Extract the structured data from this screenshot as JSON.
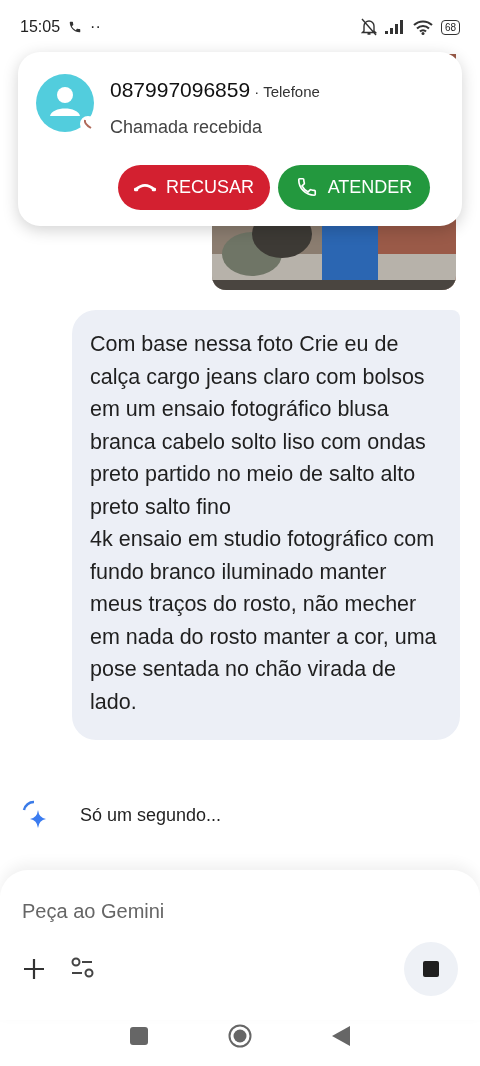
{
  "status_bar": {
    "time": "15:05",
    "more": "··",
    "battery": "68"
  },
  "call_notification": {
    "number": "087997096859",
    "separator": "·",
    "source": "Telefone",
    "status": "Chamada recebida",
    "buttons": [
      {
        "kind": "decline",
        "label": "RECUSAR"
      },
      {
        "kind": "accept",
        "label": "ATENDER"
      }
    ]
  },
  "chat": {
    "user_message": "Com base nessa foto Crie eu de calça cargo jeans claro com bolsos em um ensaio fotográfico blusa branca cabelo solto liso com ondas preto partido no meio de salto alto preto salto fino\n4k ensaio em studio fotográfico com fundo branco iluminado manter meus traços do rosto, não mecher em nada do rosto manter a cor, uma pose sentada no chão virada de lado.",
    "loading_text": "Só um segundo..."
  },
  "composer": {
    "placeholder": "Peça ao Gemini"
  }
}
